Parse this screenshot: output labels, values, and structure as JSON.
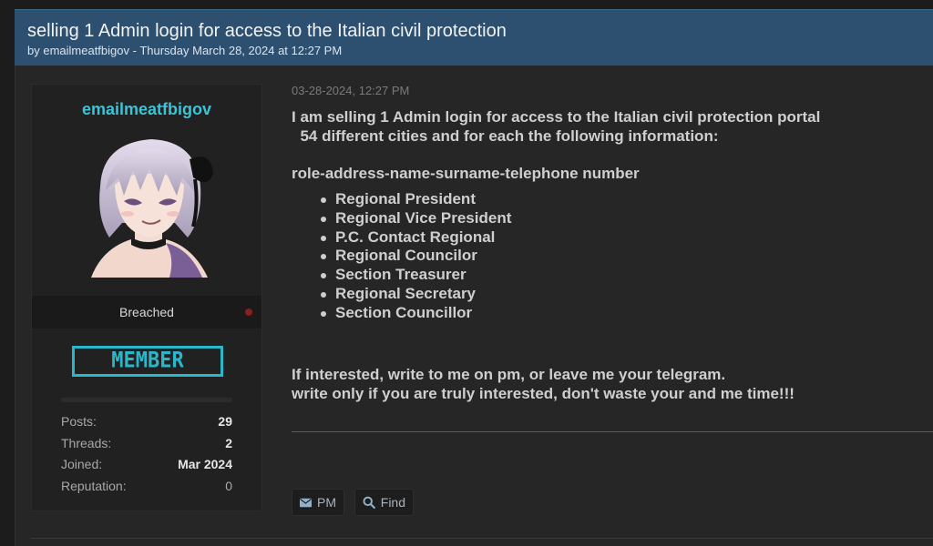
{
  "thread": {
    "title": "selling 1 Admin login for access to the Italian civil protection",
    "byline": "by emailmeatfbigov - Thursday March 28, 2024 at 12:27 PM"
  },
  "author": {
    "username": "emailmeatfbigov",
    "status": "Breached",
    "rank": "MEMBER",
    "stats": [
      {
        "label": "Posts:",
        "value": "29"
      },
      {
        "label": "Threads:",
        "value": "2"
      },
      {
        "label": "Joined:",
        "value": "Mar 2024"
      },
      {
        "label": "Reputation:",
        "value": "0"
      }
    ]
  },
  "post": {
    "date": "03-28-2024, 12:27 PM",
    "intro_line1": "I am selling 1 Admin login for access to the Italian civil protection portal",
    "intro_line2": "  54 different cities and for each the following information:",
    "fields": "role-address-name-surname-telephone number",
    "roles": [
      "Regional President",
      "Regional Vice President",
      "P.C. Contact Regional",
      "Regional Councilor",
      "Section Treasurer",
      "Regional Secretary",
      "Section Councillor"
    ],
    "outro_line1": "If interested, write to me on pm, or leave me your telegram.",
    "outro_line2": "write only if you are truly interested, don't waste your and me time!!!"
  },
  "actions": {
    "pm_label": "PM",
    "find_label": "Find"
  },
  "colors": {
    "header_bg": "#2d5070",
    "username": "#3cc3d6",
    "rank": "#2bb7c9",
    "status_dot": "#8a1f1f"
  },
  "icons": {
    "pm": "envelope-icon",
    "find": "search-icon"
  }
}
